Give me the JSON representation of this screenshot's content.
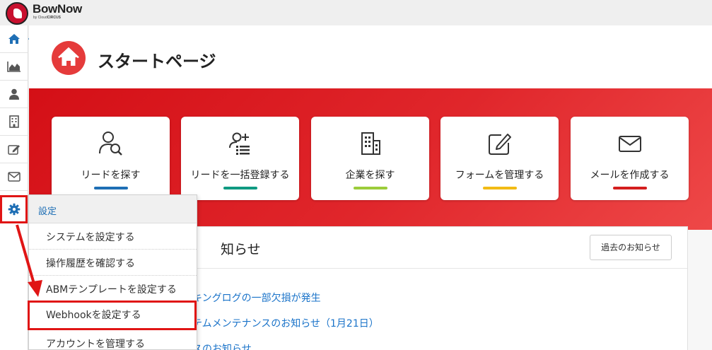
{
  "app": {
    "brand_name": "BowNow",
    "brand_sub_prefix": "by Cloud",
    "brand_sub_strong": "CIRCUS"
  },
  "page": {
    "title": "スタートページ"
  },
  "sidebar": {
    "items": [
      {
        "name": "home",
        "icon": "home-icon"
      },
      {
        "name": "analytics",
        "icon": "area-chart-icon"
      },
      {
        "name": "leads",
        "icon": "user-icon"
      },
      {
        "name": "companies",
        "icon": "building-icon"
      },
      {
        "name": "forms",
        "icon": "edit-icon"
      },
      {
        "name": "mail",
        "icon": "envelope-icon"
      },
      {
        "name": "settings",
        "icon": "gear-icon"
      }
    ]
  },
  "cards": [
    {
      "label": "リードを探す",
      "icon": "user-search-icon",
      "bar_color": "#1f6fb5"
    },
    {
      "label": "リードを一括登録する",
      "icon": "user-list-add-icon",
      "bar_color": "#0f9a82"
    },
    {
      "label": "企業を探す",
      "icon": "building-icon",
      "bar_color": "#9ccc3a"
    },
    {
      "label": "フォームを管理する",
      "icon": "edit-icon",
      "bar_color": "#f2bb15"
    },
    {
      "label": "メールを作成する",
      "icon": "envelope-icon",
      "bar_color": "#d41f1f"
    }
  ],
  "news": {
    "title_visible": "知らせ",
    "past_button": "過去のお知らせ",
    "items": [
      "キングログの一部欠損が発生",
      "テムメンテナンスのお知らせ（1月21日）",
      "スのお知らせ"
    ]
  },
  "settings_menu": {
    "header": "設定",
    "items": [
      "システムを設定する",
      "操作履歴を確認する",
      "ABMテンプレートを設定する",
      "Webhookを設定する",
      "アカウントを管理する"
    ],
    "highlighted_index": 3
  },
  "colors": {
    "brand_red": "#d40f16",
    "annotation_red": "#e01515",
    "link_blue": "#1a73c9",
    "nav_blue": "#1f6fb5"
  }
}
